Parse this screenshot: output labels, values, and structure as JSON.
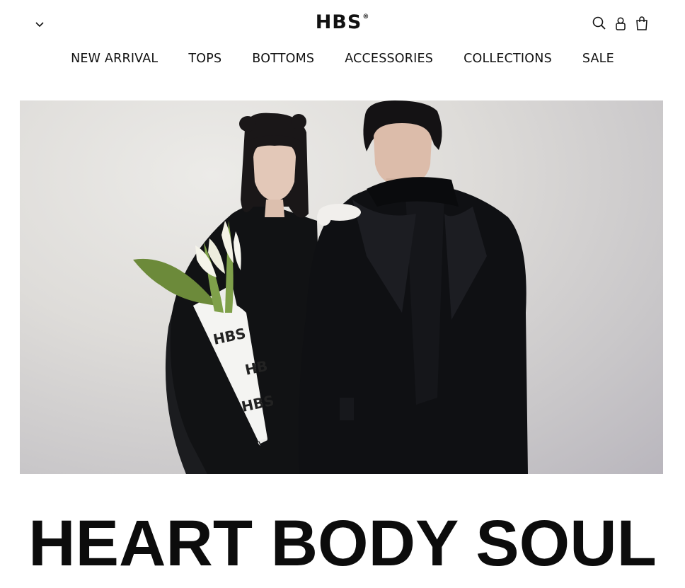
{
  "header": {
    "logo": "HBS",
    "logo_mark": "®",
    "menu_icon": "chevron-down-icon",
    "icons": [
      "search-icon",
      "account-icon",
      "cart-icon"
    ]
  },
  "nav": {
    "items": [
      {
        "label": "NEW ARRIVAL"
      },
      {
        "label": "TOPS"
      },
      {
        "label": "BOTTOMS"
      },
      {
        "label": "ACCESSORIES"
      },
      {
        "label": "COLLECTIONS"
      },
      {
        "label": "SALE"
      }
    ]
  },
  "hero": {
    "bouquet_wrap_text": [
      "HBS",
      "HB",
      "HBS"
    ]
  },
  "headline": "HEART BODY SOUL"
}
